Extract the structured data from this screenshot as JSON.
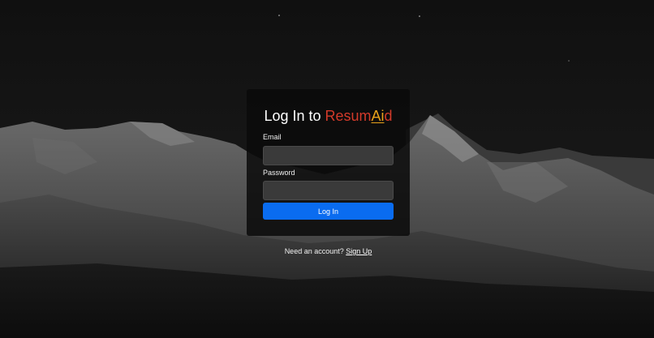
{
  "background": {
    "description_icon": "mountain-landscape-icon"
  },
  "login_card": {
    "title_prefix": "Log In to ",
    "brand_part1": "Resum",
    "brand_part2": "Ai",
    "brand_part3": "d",
    "email_label": "Email",
    "email_value": "",
    "email_placeholder": "",
    "password_label": "Password",
    "password_value": "",
    "password_placeholder": "",
    "login_button_label": "Log In"
  },
  "signup": {
    "prompt": "Need an account?",
    "link_label": "Sign Up"
  },
  "colors": {
    "brand_red": "#d23a2a",
    "brand_orange": "#e9a21a",
    "button_blue": "#0a6cf0",
    "input_bg": "#3a3a3a",
    "card_bg": "#0a0a0a"
  }
}
